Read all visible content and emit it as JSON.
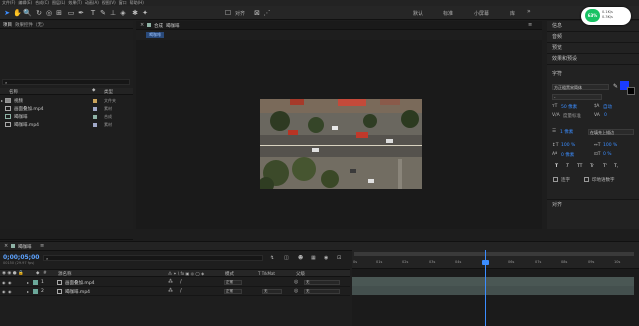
{
  "menu": [
    "文件(F)",
    "编辑(E)",
    "合成(C)",
    "图层(L)",
    "效果(T)",
    "动画(A)",
    "视图(V)",
    "窗口",
    "帮助(H)"
  ],
  "toolbar": {
    "snap_label": "对齐",
    "workspaces": [
      "默认",
      "标准",
      "小屏幕",
      "库"
    ]
  },
  "overlay_badge": {
    "percent": "63%",
    "line1": "0.1K/s",
    "line2": "0.3K/s"
  },
  "project": {
    "tabs": [
      "项目",
      "效果控件（无）"
    ],
    "col_name": "名称",
    "col_type": "类型",
    "items": [
      {
        "name": "视频",
        "type": "文件夹",
        "color": "#c9a35b",
        "icon": "folder-icon"
      },
      {
        "name": "画面叠加.mp4",
        "type": "素材",
        "color": "#a0a8c8",
        "icon": "video-file-icon"
      },
      {
        "name": "喝咖啡",
        "type": "合成",
        "color": "#8fb3a6",
        "icon": "composition-icon"
      },
      {
        "name": "喝咖啡.mp4",
        "type": "素材",
        "color": "#a0a8c8",
        "icon": "video-file-icon"
      }
    ]
  },
  "comp": {
    "tab_label": "合成",
    "comp_name": "喝咖啡"
  },
  "right_panel": {
    "sections": [
      "信息",
      "音频",
      "预览",
      "效果和预设",
      "对齐"
    ],
    "character_title": "字符",
    "font_family": "方正粗黑宋简体",
    "font_style": "-",
    "font_size": "50 像素",
    "leading": "自动",
    "kerning": "度量标准",
    "tracking": "0",
    "stroke_width": "1 像素",
    "stroke_mode": "在填充上描边",
    "vscale": "100 %",
    "hscale": "100 %",
    "baseline": "0 像素",
    "tsume": "0 %",
    "format_buttons": [
      "T",
      "T",
      "TT",
      "Tr",
      "T'",
      "T,"
    ],
    "ligature_label": "连字",
    "hindi_label": "印地语数字",
    "fill_color": "#1a3cff"
  },
  "timeline": {
    "comp_tab": "喝咖啡",
    "timecode": "0;00;05;00",
    "frame_info": "00150 (29.97 fps)",
    "headers": {
      "num": "#",
      "source": "源名称",
      "mode": "模式",
      "trkmat": "T TrkMat",
      "parent": "父级"
    },
    "layers": [
      {
        "num": "1",
        "name": "画面叠加.mp4",
        "mode": "正常",
        "trkmat": "",
        "parent": "无",
        "color": "#6ba89a"
      },
      {
        "num": "2",
        "name": "喝咖啡.mp4",
        "mode": "正常",
        "trkmat": "无",
        "parent": "无",
        "color": "#6ba89a"
      }
    ],
    "ruler_ticks": [
      "0s",
      "01s",
      "02s",
      "03s",
      "04s",
      "05s",
      "06s",
      "07s",
      "08s",
      "09s",
      "10s"
    ]
  }
}
